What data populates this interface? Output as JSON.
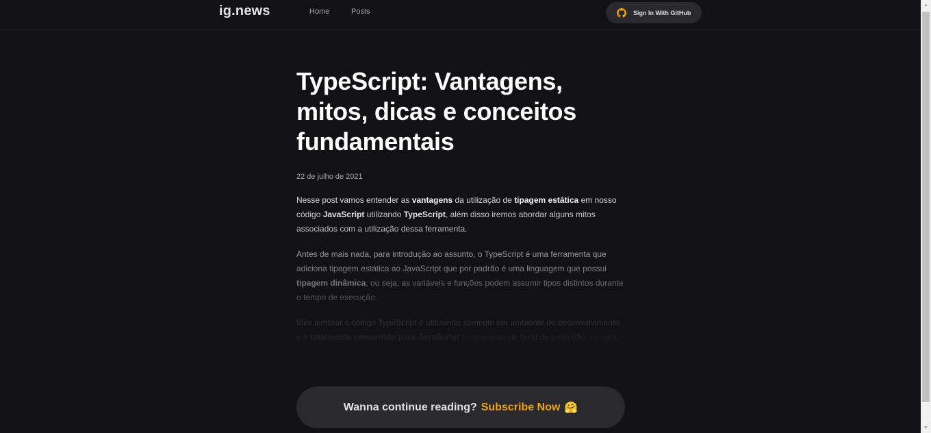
{
  "header": {
    "logo": "ig.news",
    "nav": {
      "home": "Home",
      "posts": "Posts"
    },
    "signin_label": "Sign In With GitHub",
    "signin_icon": "github-icon"
  },
  "post": {
    "title": "TypeScript: Vantagens, mitos, dicas e conceitos fundamentais",
    "date": "22 de julho de 2021",
    "p1": {
      "t1": "Nesse post vamos entender as ",
      "b1": "vantagens",
      "t2": " da utilização de ",
      "b2": "tipagem estática",
      "t3": " em nosso código ",
      "b3": "JavaScript",
      "t4": " utilizando ",
      "b4": "TypeScript",
      "t5": ", além disso iremos abordar alguns mitos associados com a utilização dessa ferramenta."
    },
    "p2": {
      "t1": "Antes de mais nada, para introdução ao assunto, o TypeScript é uma ferramenta que adiciona tipagem estática ao JavaScript que por padrão é uma linguagem que possui ",
      "b1": "tipagem dinâmica",
      "t2": ", ou seja, as variáveis e funções podem assumir tipos distintos durante o tempo de execução."
    },
    "p3": {
      "t1": "Vale lembrar o código TypeScript é utilizando somente em ambiente de desenvolvimento e é ",
      "b1": "totalmente convertido para JavaScript",
      "t2": " no processo de build de produção, ou seja, o navegador ou o Node lerão somente código JS no fim das contas."
    }
  },
  "cta": {
    "text": "Wanna continue reading?",
    "link": "Subscribe Now",
    "emoji": "🤗"
  },
  "colors": {
    "background": "#121214",
    "surface": "#29292e",
    "accent": "#eba417",
    "text": "#e1e1e6",
    "muted": "#a8a8b3"
  }
}
